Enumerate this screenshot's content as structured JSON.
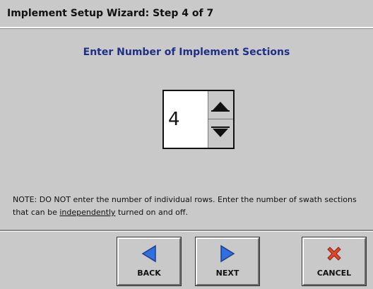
{
  "window": {
    "title": "Implement Setup Wizard:  Step 4 of 7"
  },
  "main": {
    "heading": "Enter Number of Implement Sections",
    "section_count": "4",
    "note_part1": "NOTE: DO NOT enter the number of individual rows. Enter the number of swath sections that can be ",
    "note_underlined": "independently",
    "note_part2": " turned on and off."
  },
  "buttons": {
    "back_label": "BACK",
    "next_label": "NEXT",
    "cancel_label": "CANCEL"
  },
  "icons": {
    "back": "left-arrow-icon",
    "next": "right-arrow-icon",
    "cancel": "red-x-icon",
    "increment": "up-arrow-icon",
    "decrement": "down-arrow-icon"
  },
  "colors": {
    "background": "#c9c9c9",
    "heading": "#1f2f87",
    "arrow_blue": "#2f6fe0",
    "cancel_red": "#e2462a"
  }
}
